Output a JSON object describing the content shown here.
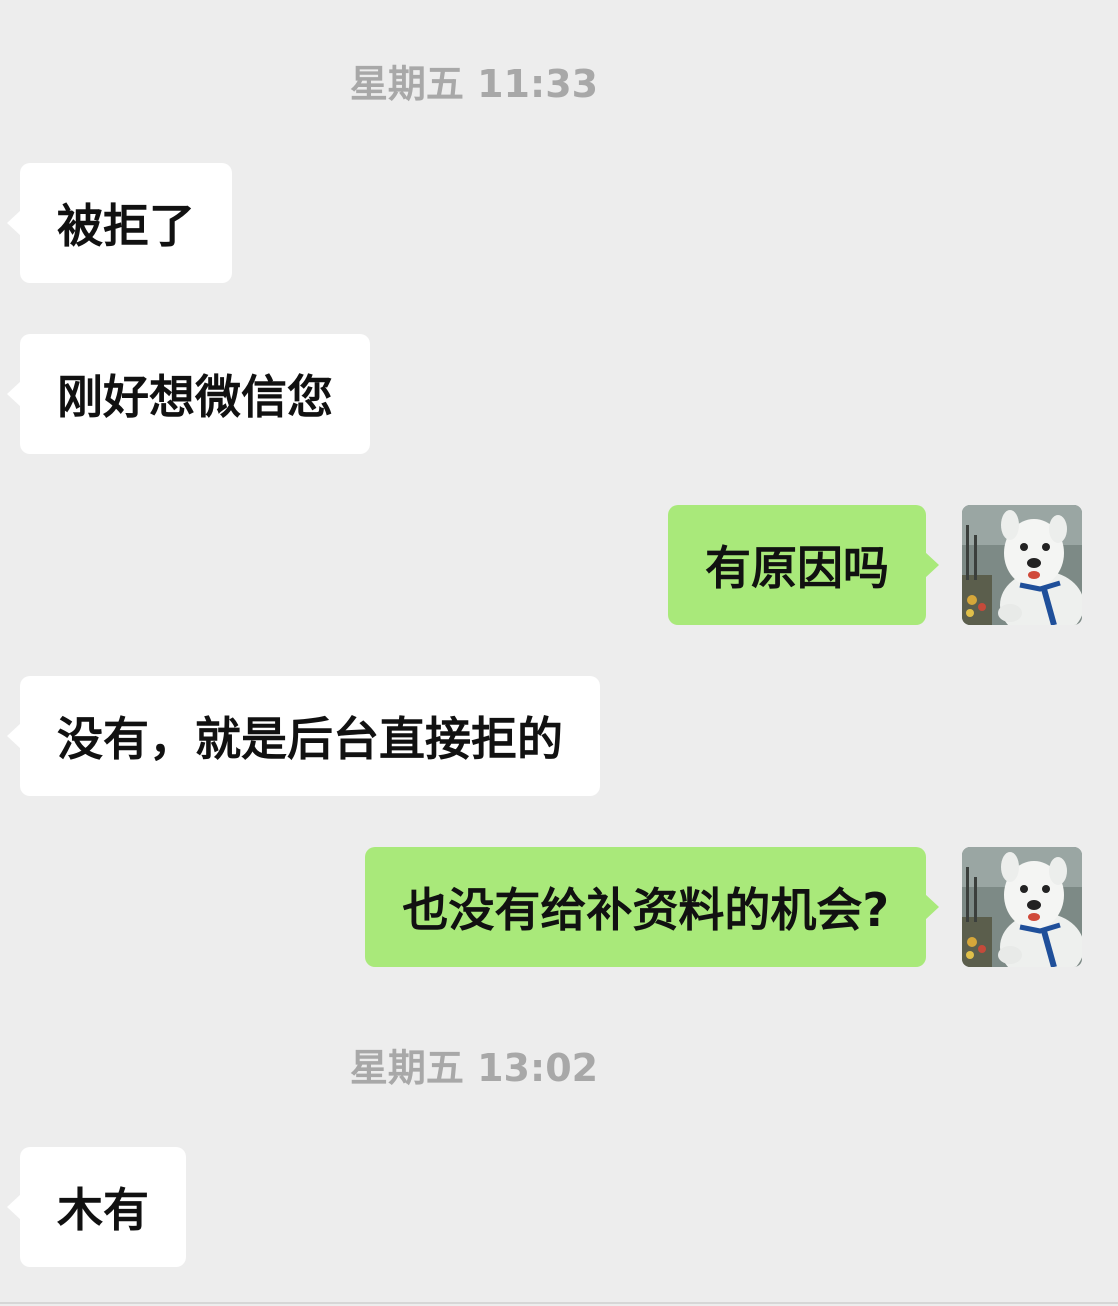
{
  "chat": {
    "timestamps": [
      "星期五 11:33",
      "星期五 13:02"
    ],
    "messages": [
      {
        "side": "incoming",
        "text": "被拒了"
      },
      {
        "side": "incoming",
        "text": "刚好想微信您"
      },
      {
        "side": "outgoing",
        "text": "有原因吗"
      },
      {
        "side": "incoming",
        "text": "没有，就是后台直接拒的"
      },
      {
        "side": "outgoing",
        "text": "也没有给补资料的机会?"
      },
      {
        "side": "incoming",
        "text": "木有"
      }
    ],
    "avatar": {
      "icon": "cartoon-dog-mascot-photo"
    },
    "colors": {
      "background": "#ededed",
      "incoming_bubble": "#ffffff",
      "outgoing_bubble": "#a9e97a",
      "timestamp_text": "#a8a8a8"
    }
  }
}
